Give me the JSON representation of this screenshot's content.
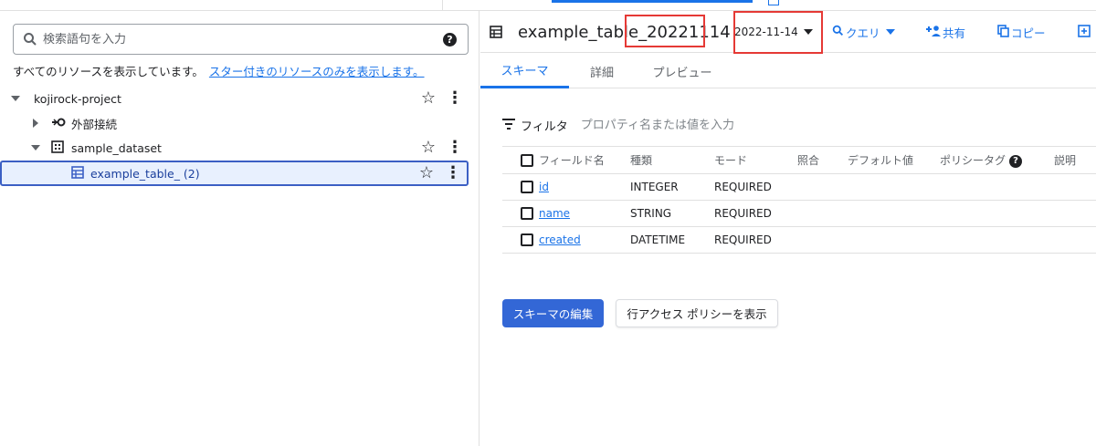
{
  "search": {
    "placeholder": "検索語句を入力",
    "help_icon": "help-icon"
  },
  "resources": {
    "note": "すべてのリソースを表示しています。",
    "starred_link": "スター付きのリソースのみを表示します。"
  },
  "tree": {
    "project": "kojirock-project",
    "external": "外部接続",
    "dataset": "sample_dataset",
    "table": "example_table_ (2)"
  },
  "table_header": {
    "title": "example_table_20221114",
    "date": "2022-11-14",
    "actions": {
      "query": "クエリ",
      "share": "共有",
      "copy": "コピー"
    }
  },
  "tabs": [
    "スキーマ",
    "詳細",
    "プレビュー"
  ],
  "filter": {
    "label": "フィルタ",
    "placeholder": "プロパティ名または値を入力"
  },
  "schema": {
    "columns": [
      "フィールド名",
      "種類",
      "モード",
      "照合",
      "デフォルト値",
      "ポリシータグ",
      "説明"
    ],
    "rows": [
      {
        "name": "id",
        "type": "INTEGER",
        "mode": "REQUIRED"
      },
      {
        "name": "name",
        "type": "STRING",
        "mode": "REQUIRED"
      },
      {
        "name": "created",
        "type": "DATETIME",
        "mode": "REQUIRED"
      }
    ]
  },
  "buttons": {
    "edit_schema": "スキーマの編集",
    "row_access": "行アクセス ポリシーを表示"
  },
  "colors": {
    "accent": "#1a73e8",
    "highlight": "#e53935",
    "primary_button": "#3367d6"
  }
}
